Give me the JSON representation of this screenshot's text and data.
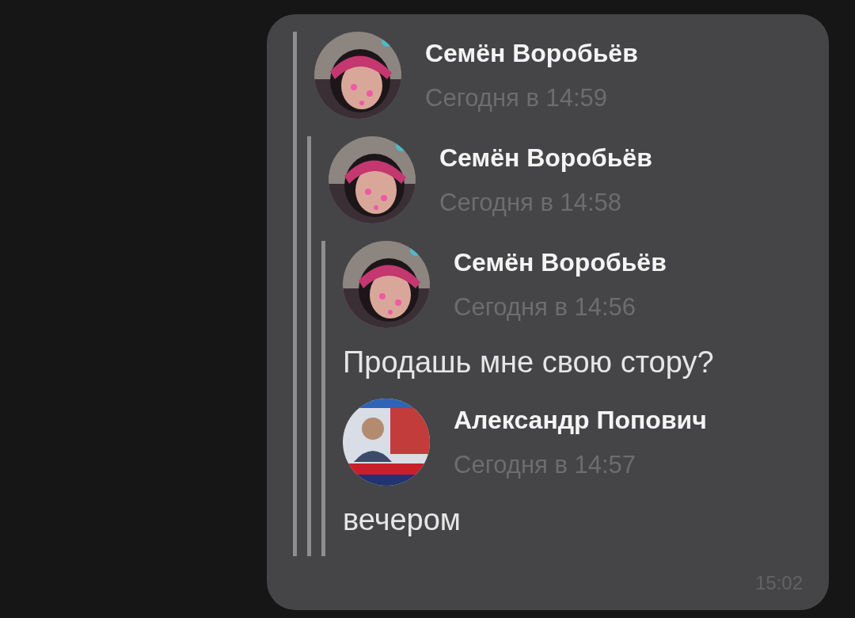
{
  "message": {
    "time": "15:02",
    "forwarded": [
      {
        "author": "Семён Воробьёв",
        "time": "Сегодня в 14:59",
        "forwarded": [
          {
            "author": "Семён Воробьёв",
            "time": "Сегодня в 14:58",
            "forwarded": [
              {
                "author": "Семён Воробьёв",
                "time": "Сегодня в 14:56",
                "text": "Продашь мне свою стору?"
              },
              {
                "author": "Александр Попович",
                "time": "Сегодня в 14:57",
                "text": "вечером"
              }
            ]
          }
        ]
      }
    ]
  }
}
